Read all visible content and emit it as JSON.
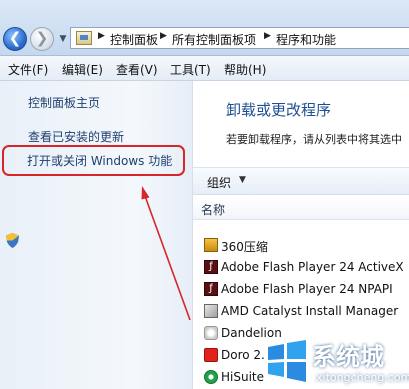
{
  "address_bar": {
    "breadcrumbs": [
      "控制面板",
      "所有控制面板项",
      "程序和功能"
    ]
  },
  "menu": [
    "文件(F)",
    "编辑(E)",
    "查看(V)",
    "工具(T)",
    "帮助(H)"
  ],
  "left_pane": {
    "home_link": "控制面板主页",
    "updates_link": "查看已安装的更新",
    "features_link": "打开或关闭 Windows 功能"
  },
  "main": {
    "title": "卸载或更改程序",
    "description": "若要卸载程序，请从列表中将其选中",
    "organize": "组织",
    "column_name": "名称",
    "programs": [
      {
        "name": "360压缩",
        "icon": "archive-icon"
      },
      {
        "name": "Adobe Flash Player 24 ActiveX",
        "icon": "flash-icon"
      },
      {
        "name": "Adobe Flash Player 24 NPAPI",
        "icon": "flash-icon"
      },
      {
        "name": "AMD Catalyst Install Manager",
        "icon": "amd-icon"
      },
      {
        "name": "Dandelion",
        "icon": "dandelion-icon"
      },
      {
        "name": "Doro 2.",
        "icon": "doro-icon"
      },
      {
        "name": "HiSuite",
        "icon": "hisuite-icon"
      }
    ]
  },
  "watermark": {
    "text": "系统城",
    "url": "xitongcheng.com"
  },
  "colors": {
    "highlight": "#d6262a",
    "link": "#1e3f6e",
    "title": "#1f4f92"
  }
}
